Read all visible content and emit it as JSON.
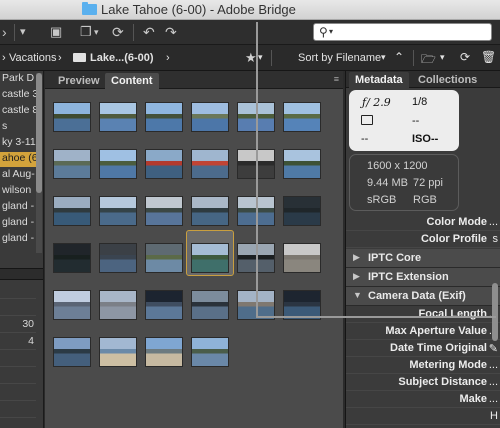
{
  "window": {
    "title": "Lake Tahoe (6-00) - Adobe Bridge"
  },
  "toolbar": {
    "icons": [
      "camera-icon",
      "copy-icon",
      "refresh-icon",
      "undo-icon",
      "redo-icon",
      "search-icon"
    ],
    "search_placeholder": ""
  },
  "pathbar": {
    "crumb_parent": "Vacations",
    "crumb_current": "Lake...(6-00)",
    "sort_label": "Sort by Filename"
  },
  "folders": {
    "items": [
      {
        "label": "Park D"
      },
      {
        "label": "castle 3"
      },
      {
        "label": "castle 8"
      },
      {
        "label": "s"
      },
      {
        "label": "ky 3-11"
      },
      {
        "label": "ahoe (6",
        "selected": true
      },
      {
        "label": "al Aug-"
      },
      {
        "label": "wilson"
      },
      {
        "label": "gland -"
      },
      {
        "label": "gland -"
      },
      {
        "label": "gland -"
      }
    ]
  },
  "left_meta": {
    "rows": [
      {
        "value": ""
      },
      {
        "value": ""
      },
      {
        "value": "30"
      },
      {
        "value": "4"
      },
      {
        "value": ""
      },
      {
        "value": ""
      },
      {
        "value": ""
      },
      {
        "value": ""
      },
      {
        "value": ""
      }
    ]
  },
  "content": {
    "tabs": [
      {
        "label": "Preview"
      },
      {
        "label": "Content"
      }
    ],
    "thumbnails": [
      {
        "sky": "#8db4dc",
        "land": "#3f4b30",
        "water": "#4b6f96"
      },
      {
        "sky": "#a9c6e2",
        "land": "#505b3c",
        "water": "#5a82b2"
      },
      {
        "sky": "#8fb6df",
        "land": "#44513a",
        "water": "#4d78a9"
      },
      {
        "sky": "#9ebde0",
        "land": "#6b7859",
        "water": "#4c76a8"
      },
      {
        "sky": "#aac2d8",
        "land": "#4d5d3a",
        "water": "#587db0"
      },
      {
        "sky": "#9fc0e0",
        "land": "#5a6b44",
        "water": "#5583b8"
      },
      {
        "sky": "#9fb2c8",
        "land": "#5b6a55",
        "water": "#5c7b99"
      },
      {
        "sky": "#9fc0e3",
        "land": "#4b5d3e",
        "water": "#4f78a6"
      },
      {
        "sky": "#8aa9c8",
        "land": "#b23a2e",
        "water": "#3f6080"
      },
      {
        "sky": "#9fb6cf",
        "land": "#c04435",
        "water": "#4c6b8c"
      },
      {
        "sky": "#c8c8c8",
        "land": "#2b2b2b",
        "water": "#3d3d3d"
      },
      {
        "sky": "#a9c3de",
        "land": "#3d5236",
        "water": "#4f7aa6"
      },
      {
        "sky": "#9aacc0",
        "land": "#2f3a3e",
        "water": "#385a78"
      },
      {
        "sky": "#b5c8dc",
        "land": "#344348",
        "water": "#4a6a8a"
      },
      {
        "sky": "#c0c8d0",
        "land": "#3c4845",
        "water": "#58759a"
      },
      {
        "sky": "#aab8c8",
        "land": "#2e3b40",
        "water": "#466684"
      },
      {
        "sky": "#b8c4d0",
        "land": "#3b4a45",
        "water": "#4d6d90"
      },
      {
        "sky": "#283036",
        "land": "#1f262a",
        "water": "#2a3a48"
      },
      {
        "sky": "#20252a",
        "land": "#18201f",
        "water": "#222c30"
      },
      {
        "sky": "#3b4046",
        "land": "#3a4450",
        "water": "#4c6480"
      },
      {
        "sky": "#5e6a72",
        "land": "#5b6a48",
        "water": "#6d8aa5"
      },
      {
        "sky": "#a5bcd4",
        "land": "#3e5a3e",
        "water": "#3f6f6a"
      },
      {
        "sky": "#9aa6b2",
        "land": "#1b1f21",
        "water": "#545f6a"
      },
      {
        "sky": "#c8c8c8",
        "land": "#7b7770",
        "water": "#8a867e"
      },
      {
        "sky": "#c0cde0",
        "land": "#5a6474",
        "water": "#6d7f96"
      },
      {
        "sky": "#a8b6c8",
        "land": "#7b7f87",
        "water": "#8d96a4"
      },
      {
        "sky": "#1c2430",
        "land": "#3f4d60",
        "water": "#5c7898"
      },
      {
        "sky": "#7c8c9c",
        "land": "#2a323a",
        "water": "#5a7088"
      },
      {
        "sky": "#a3b3c6",
        "land": "#7f7870",
        "water": "#4f6d8a"
      },
      {
        "sky": "#1d2530",
        "land": "#2b3542",
        "water": "#3c5a78"
      },
      {
        "sky": "#7e9cc2",
        "land": "#2b3a45",
        "water": "#445f7c"
      },
      {
        "sky": "#a2b8d2",
        "land": "#6b8aa8",
        "water": "#cdbfa3"
      },
      {
        "sky": "#7fa6d2",
        "land": "#6c7a80",
        "water": "#c6b9a1"
      },
      {
        "sky": "#8fb3d8",
        "land": "#4a5d4a",
        "water": "#6a88a8"
      }
    ]
  },
  "metadata_panel": {
    "tabs": [
      {
        "label": "Metadata"
      },
      {
        "label": "Collections"
      }
    ],
    "camera": {
      "aperture": "ƒ/ 2.9",
      "shutter": "1/8",
      "exposure_comp": "--",
      "metering": "--",
      "iso": "ISO--",
      "white_balance": "--"
    },
    "file": {
      "dimensions": "1600 x 1200",
      "size": "9.44 MB",
      "resolution": "72 ppi",
      "profile": "sRGB",
      "color_mode": "RGB"
    },
    "file_props": [
      {
        "label": "Color Mode",
        "value": "..."
      },
      {
        "label": "Color Profile",
        "value": "s"
      }
    ],
    "sections": [
      {
        "label": "IPTC Core",
        "expanded": false
      },
      {
        "label": "IPTC Extension",
        "expanded": false
      },
      {
        "label": "Camera Data (Exif)",
        "expanded": true
      }
    ],
    "exif_props": [
      {
        "label": "Focal Length",
        "value": "..."
      },
      {
        "label": "Max Aperture Value",
        "value": "..."
      },
      {
        "label": "Date Time Original",
        "value": "✎"
      },
      {
        "label": "Metering Mode",
        "value": "..."
      },
      {
        "label": "Subject Distance",
        "value": "..."
      },
      {
        "label": "Make",
        "value": "..."
      },
      {
        "label": "",
        "value": "H"
      },
      {
        "label": "",
        "value": "..."
      }
    ]
  }
}
